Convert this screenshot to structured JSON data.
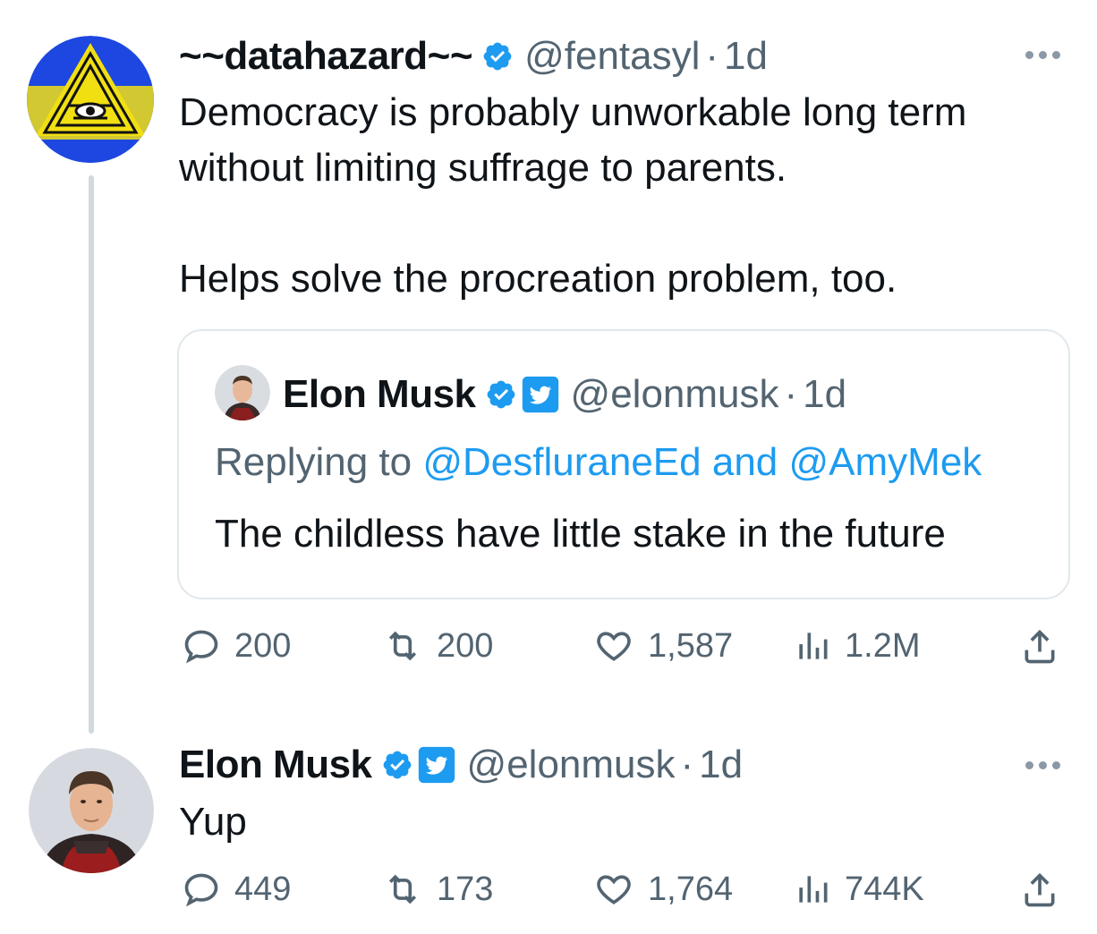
{
  "tweet": {
    "display_name": "~~datahazard~~",
    "handle": "@fentasyl",
    "separator": "·",
    "time": "1d",
    "text": "Democracy is probably unworkable long term\nwithout limiting suffrage to parents.\n\nHelps solve the procreation problem, too.",
    "quote": {
      "display_name": "Elon Musk",
      "handle": "@elonmusk",
      "separator": "·",
      "time": "1d",
      "replying_prefix": "Replying to ",
      "reply_to_1": "@DesfluraneEd",
      "reply_joiner": " and ",
      "reply_to_2": "@AmyMek",
      "text": "The childless have little stake in the future"
    },
    "metrics": {
      "replies": "200",
      "retweets": "200",
      "likes": "1,587",
      "views": "1.2M"
    }
  },
  "reply": {
    "display_name": "Elon Musk",
    "handle": "@elonmusk",
    "separator": "·",
    "time": "1d",
    "text": "Yup",
    "metrics": {
      "replies": "449",
      "retweets": "173",
      "likes": "1,764",
      "views": "744K"
    }
  },
  "icons": {
    "reply": "reply-bubble-icon",
    "retweet": "retweet-icon",
    "like": "heart-icon",
    "views": "views-bar-icon",
    "share": "share-icon",
    "verified": "verified-badge-icon",
    "affiliate": "twitter-affiliate-icon",
    "more": "more-options-icon"
  },
  "colors": {
    "accent": "#1d9bf0",
    "muted": "#536471",
    "text": "#0f1419",
    "border": "#e1e8ed"
  }
}
